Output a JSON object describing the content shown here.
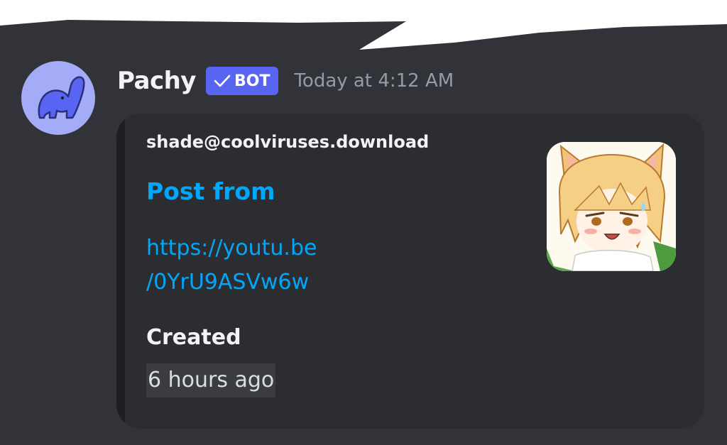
{
  "message": {
    "author": "Pachy",
    "bot_tag": "BOT",
    "timestamp": "Today at 4:12 AM",
    "avatar_icon": "elephant-icon",
    "embed": {
      "author_name": "shade@coolviruses.download",
      "title": "Post from",
      "link_line_1": "https://youtu.be",
      "link_line_2": "/0YrU9ASVw6w",
      "field_name": "Created",
      "field_value": "6 hours ago",
      "thumbnail": "anime-fox-girl-thumbnail"
    }
  },
  "colors": {
    "background": "#313338",
    "embed_background": "#2b2d31",
    "link": "#00a8fc",
    "bot_badge": "#5865f2",
    "avatar_background": "#a4abf7"
  }
}
